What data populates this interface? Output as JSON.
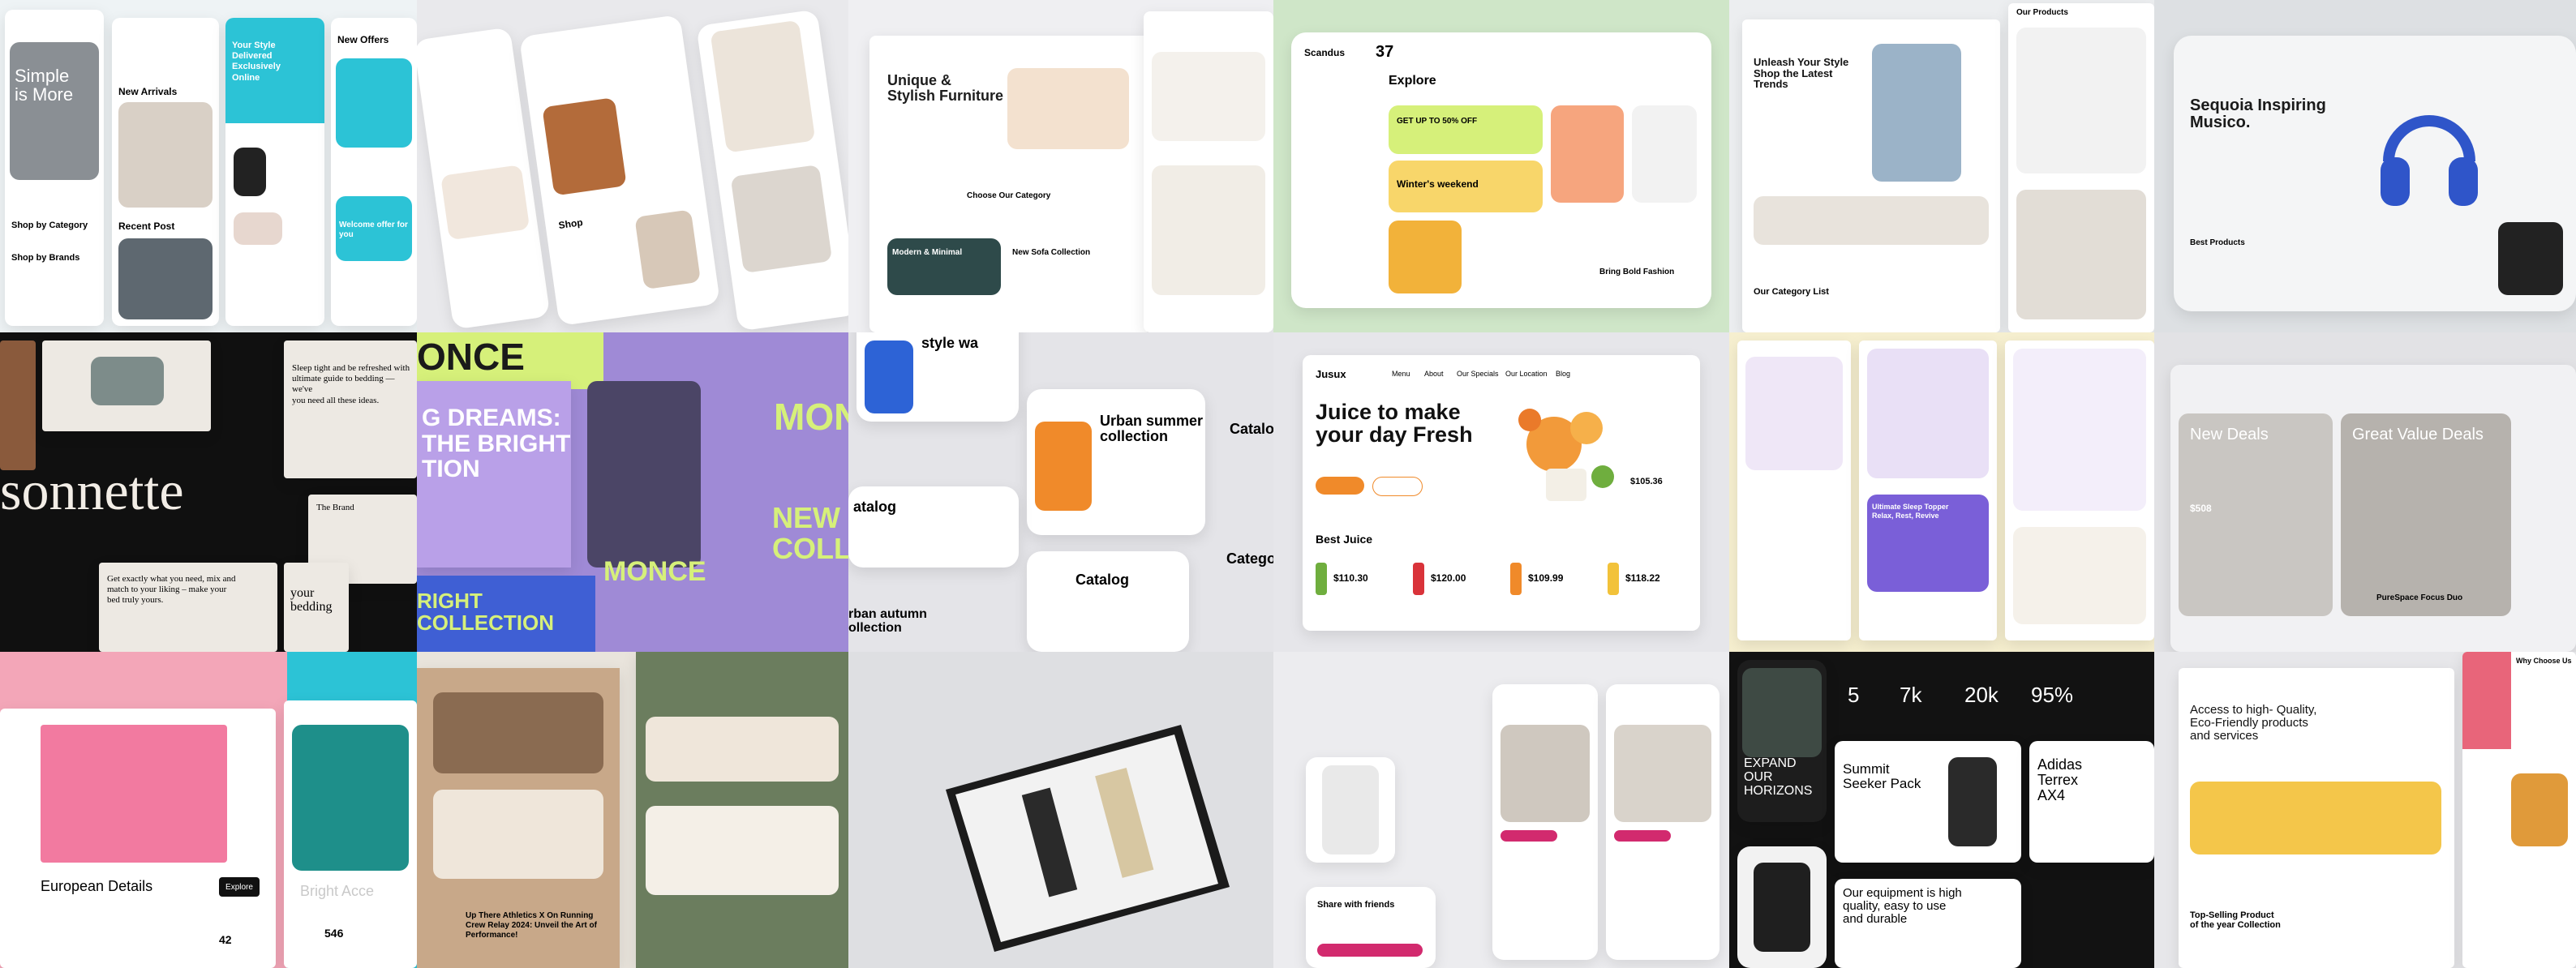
{
  "tiles": {
    "t1": {
      "hero_title": "Simple\nis More",
      "new_arrivals": "New Arrivals",
      "recent_post": "Recent Post",
      "shop_by_category": "Shop by Category",
      "shop_by_brands": "Shop by Brands",
      "promo_title": "Your Style\nDelivered\nExclusively\nOnline",
      "new_offers": "New Offers",
      "welcome": "Welcome offer for\nyou"
    },
    "t2": {
      "label": "Shop"
    },
    "t3": {
      "hero_title": "Unique &\nStylish Furniture",
      "choose_category": "Choose Our Category",
      "modern_minimal": "Modern & Minimal",
      "new_sofa": "New Sofa Collection"
    },
    "t4": {
      "brand": "Scandus",
      "count": "37",
      "explore": "Explore",
      "promo": "GET UP TO 50% OFF",
      "winter": "Winter's weekend",
      "bold": "Bring Bold Fashion"
    },
    "t5": {
      "hero_title": "Unleash Your Style\nShop the Latest\nTrends",
      "our_products": "Our Products",
      "category_list": "Our Category List"
    },
    "t6": {
      "hero_title": "Sequoia Inspiring\nMusico.",
      "products": "Best Products"
    },
    "t7": {
      "sonnette": "sonnette",
      "sleep": "Sleep tight and be refreshed with\nultimate guide to bedding — we've\nyou need all these ideas.",
      "get_exactly": "Get exactly what you need, mix and\nmatch to your liking – make your\nbed truly yours.",
      "your_bedding": "your\nbedding",
      "the_brand": "The Brand"
    },
    "t8": {
      "dreams": "G DREAMS:\nTHE BRIGHT\nTION",
      "once": "ONCE",
      "monce": "MONCE",
      "mon": "MON",
      "new_coll": "NEW\nCOLL",
      "bright": "RIGHT\nCOLLECTION"
    },
    "t9": {
      "style": "style wa",
      "urban_summer": "Urban summer\ncollection",
      "catalog1": "Catalog",
      "catalog2": "atalog",
      "catalog3": "Catalog",
      "catalog4": "Catego",
      "urban_autumn": "rban autumn\nollection"
    },
    "t10": {
      "brand": "Jusux",
      "nav": [
        "Menu",
        "About",
        "Our Specials",
        "Our Location",
        "Blog"
      ],
      "hero_title": "Juice to make\nyour day Fresh",
      "best_juice": "Best Juice",
      "prices": [
        "$110.30",
        "$120.00",
        "$109.99",
        "$118.22"
      ],
      "feature_price": "$105.36"
    },
    "t11": {
      "ultimate": "Ultimate Sleep Topper\nRelax, Rest, Revive"
    },
    "t12": {
      "new_deals": "New Deals",
      "great_value": "Great Value Deals",
      "price": "$508",
      "focus": "PureSpace Focus Duo"
    },
    "t13": {
      "european": "European Details",
      "explore": "Explore",
      "bright": "Bright Acce",
      "num1": "42",
      "num2": "546"
    },
    "t14": {
      "athletics": "Up There Athletics X On Running\nCrew Relay 2024: Unveil the Art of\nPerformance!"
    },
    "t16": {
      "share": "Share with friends"
    },
    "t17": {
      "stats": [
        "5",
        "7k",
        "20k",
        "95%"
      ],
      "expand": "EXPAND\nOUR\nHORIZONS",
      "summit": "Summit\nSeeker Pack",
      "adidas": "Adidas\nTerrex\nAX4",
      "equipment": "Our equipment is high\nquality, easy to use\nand durable"
    },
    "t18": {
      "hero_title": "Access to high- Quality,\nEco-Friendly products\nand services",
      "why": "Why Choose Us",
      "top_selling": "Top-Selling Product\nof the year Collection"
    }
  },
  "colors": {
    "pink": "#f3a6b8",
    "cyan": "#2cc3d6",
    "lime": "#d6f07a",
    "purple": "#b9a0e8",
    "orange": "#f08a2a",
    "dark": "#121212",
    "blue": "#1e63d6",
    "teal": "#1e8f8a"
  }
}
